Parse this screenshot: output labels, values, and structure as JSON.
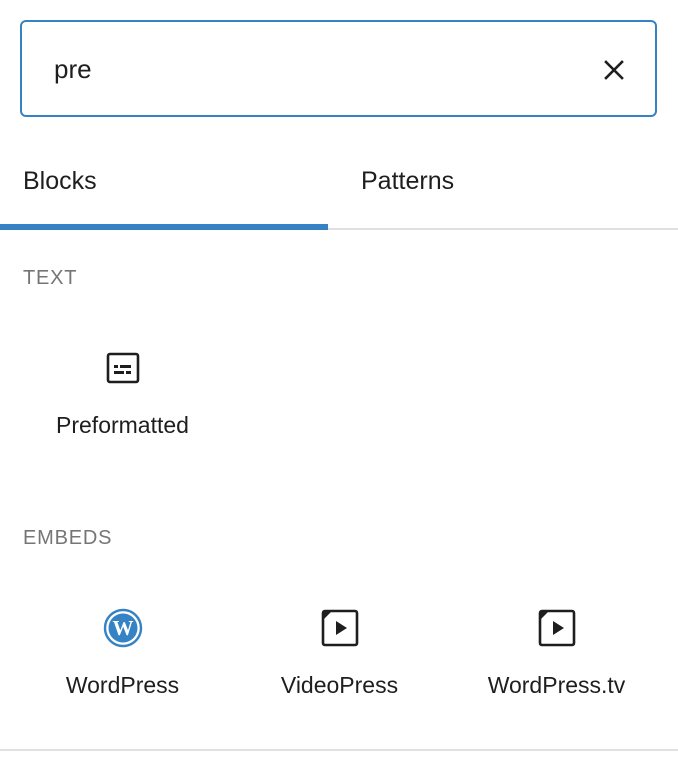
{
  "search": {
    "value": "pre",
    "clear_icon": "close-icon"
  },
  "tabs": [
    {
      "label": "Blocks",
      "active": true
    },
    {
      "label": "Patterns",
      "active": false
    }
  ],
  "sections": [
    {
      "heading": "TEXT",
      "items": [
        {
          "label": "Preformatted",
          "icon": "preformatted-icon"
        }
      ]
    },
    {
      "heading": "EMBEDS",
      "items": [
        {
          "label": "WordPress",
          "icon": "wordpress-logo-icon"
        },
        {
          "label": "VideoPress",
          "icon": "video-embed-icon"
        },
        {
          "label": "WordPress.tv",
          "icon": "video-embed-icon"
        }
      ]
    }
  ],
  "colors": {
    "accent": "#3582c4",
    "text": "#1e1e1e",
    "muted": "#757575",
    "divider": "#e0e0e0"
  }
}
